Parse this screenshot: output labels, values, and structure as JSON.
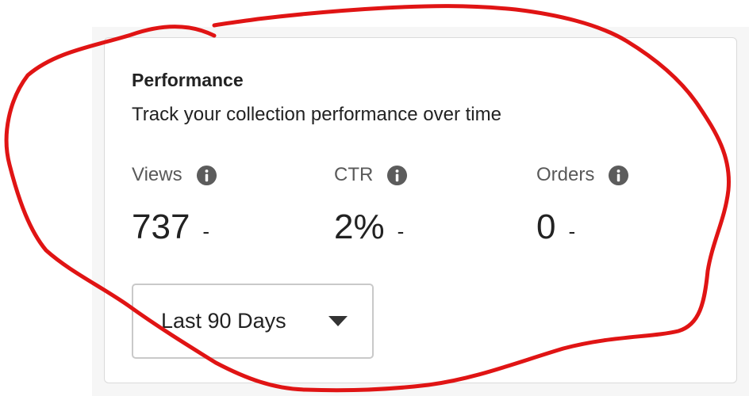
{
  "card": {
    "title": "Performance",
    "subtitle": "Track your collection performance over time"
  },
  "metrics": [
    {
      "label": "Views",
      "value": "737",
      "trend": "-",
      "icon": "info-icon"
    },
    {
      "label": "CTR",
      "value": "2%",
      "trend": "-",
      "icon": "info-icon"
    },
    {
      "label": "Orders",
      "value": "0",
      "trend": "-",
      "icon": "info-icon"
    }
  ],
  "date_range": {
    "selected": "Last 90 Days",
    "icon": "caret-down-icon"
  },
  "colors": {
    "annotation": "#e01414",
    "icon": "#5c5c5c",
    "border": "#dadada"
  }
}
